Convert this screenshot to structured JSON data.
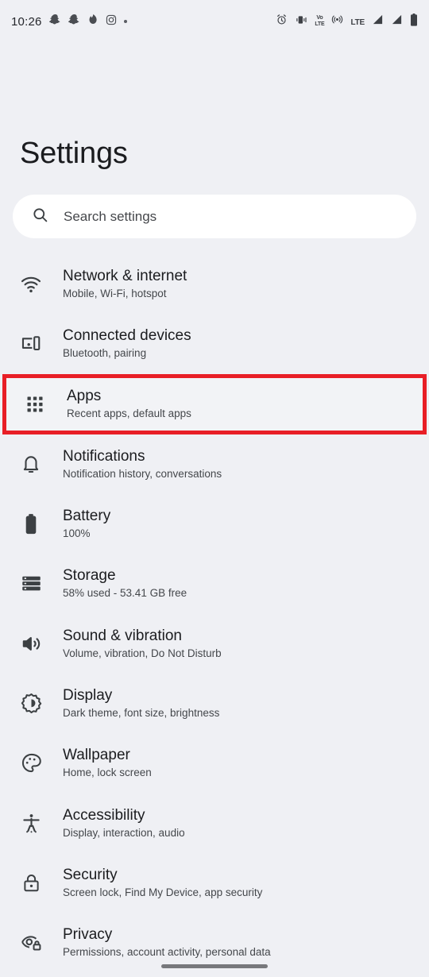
{
  "status_bar": {
    "time": "10:26",
    "left_icons": [
      {
        "name": "snapchat-icon"
      },
      {
        "name": "snapchat-icon"
      },
      {
        "name": "tinder-flame-icon"
      },
      {
        "name": "instagram-icon"
      },
      {
        "name": "more-notifications-dot-icon"
      }
    ],
    "right_icons": [
      {
        "name": "alarm-icon"
      },
      {
        "name": "vibrate-icon"
      },
      {
        "name": "volte-icon",
        "label_top": "VoLTE",
        "label_line1": "Vo",
        "label_line2": "LTE"
      },
      {
        "name": "hotspot-icon"
      },
      {
        "name": "lte-icon",
        "label": "LTE"
      },
      {
        "name": "signal-bars-icon"
      },
      {
        "name": "signal-bars-icon"
      },
      {
        "name": "battery-icon"
      }
    ]
  },
  "header": {
    "title": "Settings"
  },
  "search": {
    "placeholder": "Search settings",
    "icon": "search-icon"
  },
  "settings": {
    "items": [
      {
        "id": "network-internet",
        "icon": "wifi-icon",
        "title": "Network & internet",
        "subtitle": "Mobile, Wi-Fi, hotspot",
        "highlighted": false
      },
      {
        "id": "connected-devices",
        "icon": "connected-devices-icon",
        "title": "Connected devices",
        "subtitle": "Bluetooth, pairing",
        "highlighted": false
      },
      {
        "id": "apps",
        "icon": "apps-grid-icon",
        "title": "Apps",
        "subtitle": "Recent apps, default apps",
        "highlighted": true
      },
      {
        "id": "notifications",
        "icon": "bell-icon",
        "title": "Notifications",
        "subtitle": "Notification history, conversations",
        "highlighted": false
      },
      {
        "id": "battery",
        "icon": "battery-icon",
        "title": "Battery",
        "subtitle": "100%",
        "highlighted": false
      },
      {
        "id": "storage",
        "icon": "storage-icon",
        "title": "Storage",
        "subtitle": "58% used - 53.41 GB free",
        "highlighted": false
      },
      {
        "id": "sound-vibration",
        "icon": "volume-icon",
        "title": "Sound & vibration",
        "subtitle": "Volume, vibration, Do Not Disturb",
        "highlighted": false
      },
      {
        "id": "display",
        "icon": "brightness-icon",
        "title": "Display",
        "subtitle": "Dark theme, font size, brightness",
        "highlighted": false
      },
      {
        "id": "wallpaper",
        "icon": "palette-icon",
        "title": "Wallpaper",
        "subtitle": "Home, lock screen",
        "highlighted": false
      },
      {
        "id": "accessibility",
        "icon": "accessibility-person-icon",
        "title": "Accessibility",
        "subtitle": "Display, interaction, audio",
        "highlighted": false
      },
      {
        "id": "security",
        "icon": "lock-icon",
        "title": "Security",
        "subtitle": "Screen lock, Find My Device, app security",
        "highlighted": false
      },
      {
        "id": "privacy",
        "icon": "eye-lock-icon",
        "title": "Privacy",
        "subtitle": "Permissions, account activity, personal data",
        "highlighted": false
      }
    ]
  },
  "navigation": {
    "gesture_bar": "home-gesture-bar"
  },
  "colors": {
    "background": "#eff0f4",
    "search_background": "#ffffff",
    "highlight_border": "#e81e26",
    "text_primary": "#1b1c1f",
    "text_secondary": "#44474b"
  }
}
